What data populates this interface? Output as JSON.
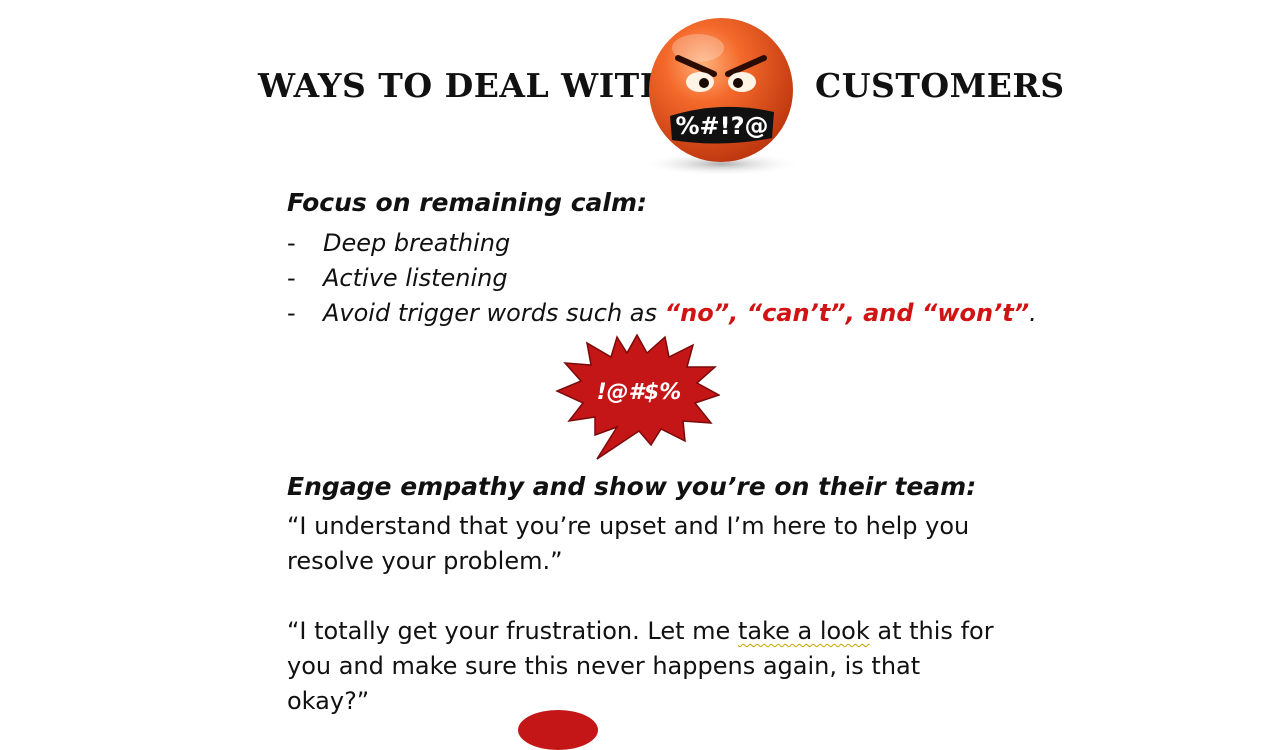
{
  "title": {
    "left": "WAYS TO DEAL WITH",
    "right": "CUSTOMERS"
  },
  "emoji": {
    "icon": "angry-face-icon",
    "mouth_text": "%#!?@",
    "colors": {
      "face": "#e8531c",
      "band": "#111111"
    }
  },
  "section1": {
    "heading": "Focus on remaining calm:",
    "bullets": [
      {
        "dash": "-",
        "text": "Deep breathing"
      },
      {
        "dash": "-",
        "text": "Active listening"
      }
    ],
    "bullet3": {
      "dash": "-",
      "prefix": "Avoid trigger words such as ",
      "emph": "“no”, “can’t”, and “won’t”",
      "suffix": "."
    }
  },
  "burst": {
    "icon": "speech-burst-icon",
    "text": "!@#$%",
    "color": "#c41616"
  },
  "section2": {
    "heading": "Engage empathy and show you’re on their team:",
    "quote1": "“I understand that you’re upset and I’m here to help you resolve your problem.”",
    "quote2_a": "“I totally get your frustration. Let me ",
    "quote2_underlined": "take a look",
    "quote2_b": " at this for you and make sure this never happens again, is that okay?”"
  }
}
